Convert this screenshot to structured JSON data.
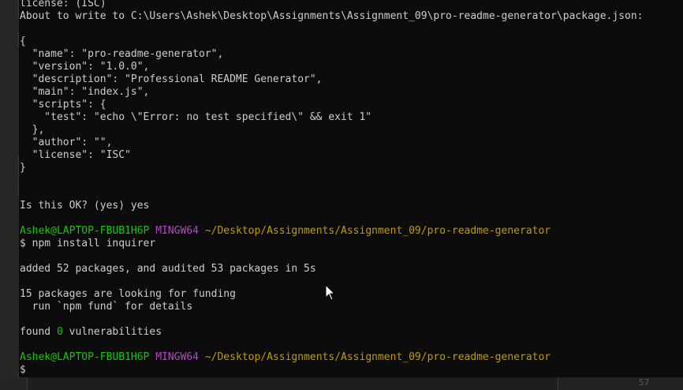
{
  "terminal": {
    "line_license_top": "license: (ISC)",
    "line_about_prefix": "About to write to ",
    "line_about_path": "C:\\Users\\Ashek\\Desktop\\Assignments\\Assignment_09\\pro-readme-generator\\package.json:",
    "json": {
      "open": "{",
      "name": "  \"name\": \"pro-readme-generator\",",
      "version": "  \"version\": \"1.0.0\",",
      "description": "  \"description\": \"Professional README Generator\",",
      "main": "  \"main\": \"index.js\",",
      "scripts_open": "  \"scripts\": {",
      "test": "    \"test\": \"echo \\\"Error: no test specified\\\" && exit 1\"",
      "scripts_close": "  },",
      "author": "  \"author\": \"\",",
      "license": "  \"license\": \"ISC\"",
      "close": "}"
    },
    "ok_prompt": "Is this OK? (yes) yes",
    "prompt1": {
      "user_host": "Ashek@LAPTOP-FBUB1H6P",
      "shell": "MINGW64",
      "path": "~/Desktop/Assignments/Assignment_09/pro-readme-generator"
    },
    "command": "$ npm install inquirer",
    "added_line": "added 52 packages, and audited 53 packages in 5s",
    "funding_line": "15 packages are looking for funding",
    "fund_hint": "  run `npm fund` for details",
    "found_prefix": "found ",
    "found_count": "0",
    "found_suffix": " vulnerabilities",
    "prompt2": {
      "user_host": "Ashek@LAPTOP-FBUB1H6P",
      "shell": "MINGW64",
      "path": "~/Desktop/Assignments/Assignment_09/pro-readme-generator"
    },
    "final_prompt": "$"
  },
  "status_number": "57",
  "colors": {
    "background": "#0c0c0c",
    "text": "#cccccc",
    "green": "#16c60c",
    "magenta": "#b148c6",
    "yellow": "#c19c00"
  }
}
